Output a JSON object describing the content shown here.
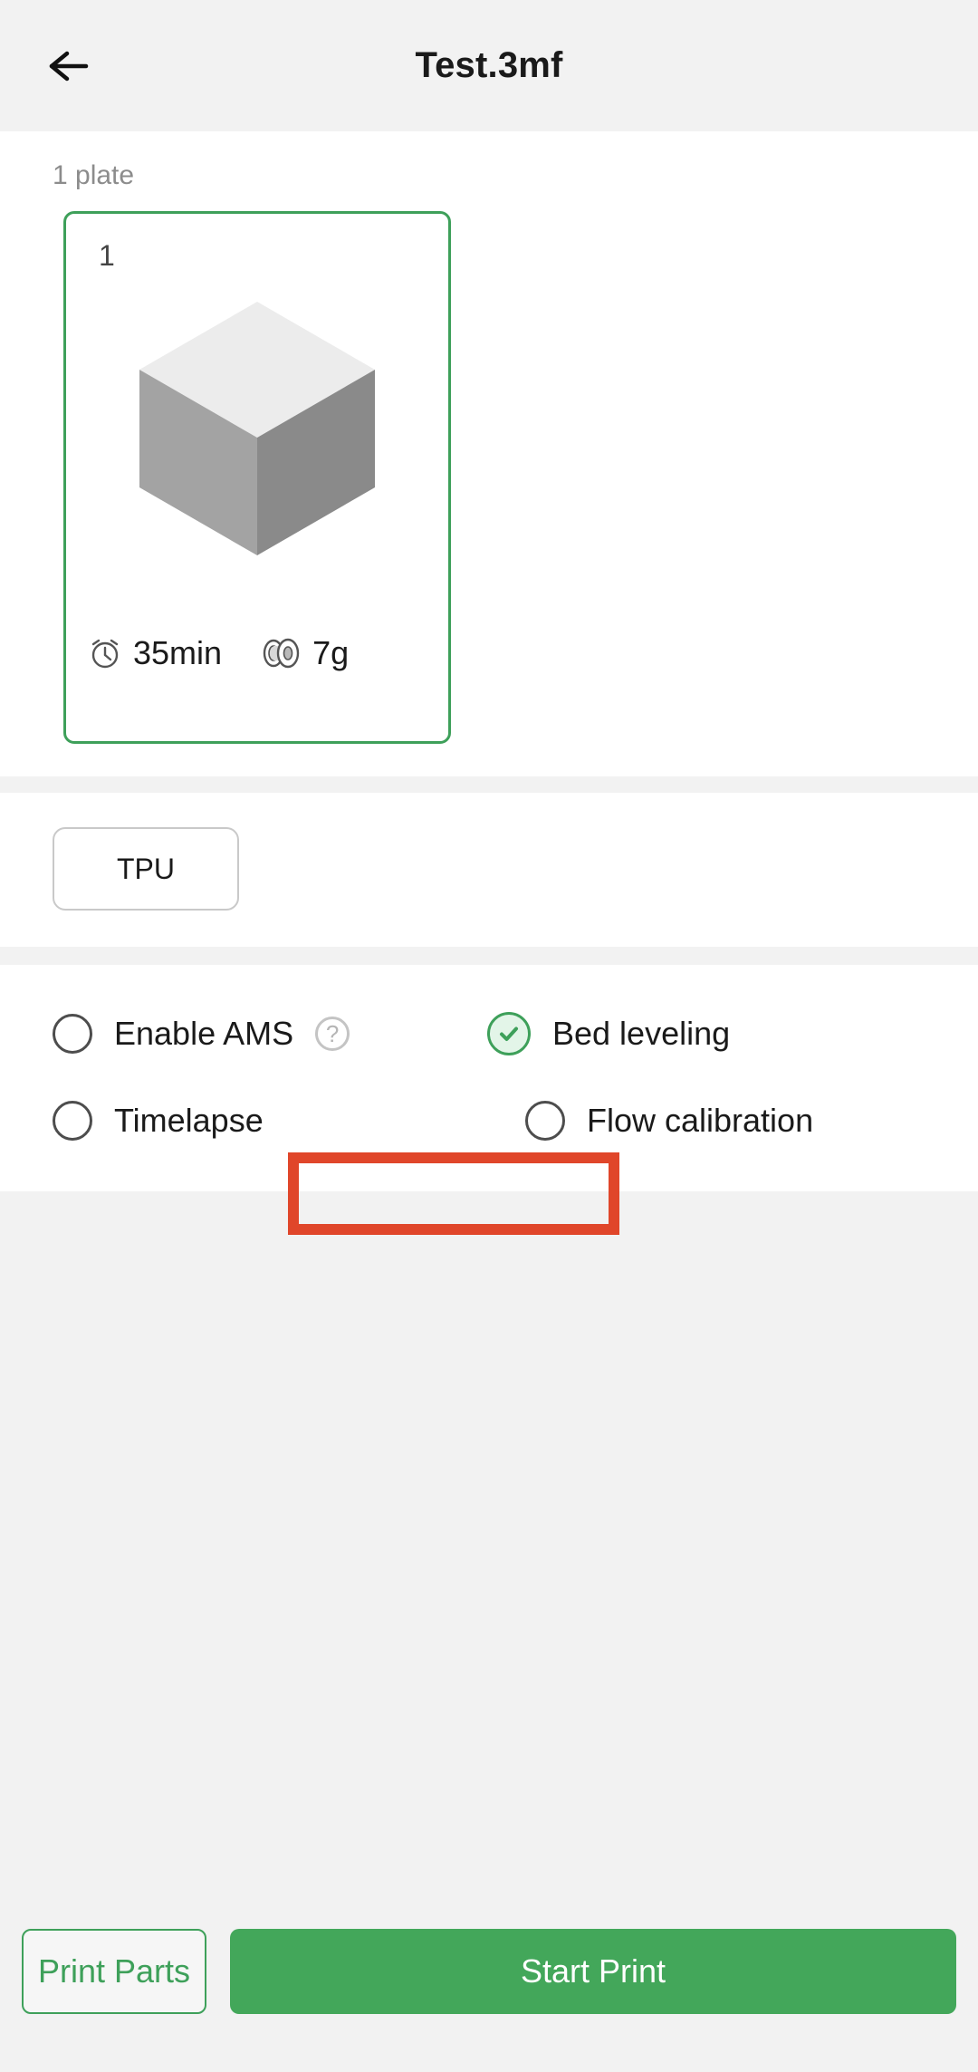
{
  "header": {
    "back_icon": "arrow-left-icon",
    "title": "Test.3mf"
  },
  "plates": {
    "count_label": "1 plate",
    "items": [
      {
        "index": "1",
        "time_icon": "clock-icon",
        "time": "35min",
        "weight_icon": "filament-spool-icon",
        "weight": "7g",
        "selected": true
      }
    ]
  },
  "filament": {
    "chips": [
      {
        "label": "TPU"
      }
    ]
  },
  "options": [
    {
      "label": "Enable AMS",
      "checked": false,
      "help_icon": "question-mark-icon",
      "has_help": true
    },
    {
      "label": "Bed leveling",
      "checked": true,
      "has_help": false
    },
    {
      "label": "Timelapse",
      "checked": false,
      "has_help": false
    },
    {
      "label": "Flow calibration",
      "checked": false,
      "has_help": false,
      "highlighted": true
    }
  ],
  "footer": {
    "secondary_label": "Print Parts",
    "primary_label": "Start Print"
  },
  "colors": {
    "accent_green": "#43a75a",
    "card_border_green": "#3ea05a",
    "highlight_red": "#e0462a",
    "page_bg": "#f2f2f2",
    "panel_bg": "#ffffff"
  }
}
